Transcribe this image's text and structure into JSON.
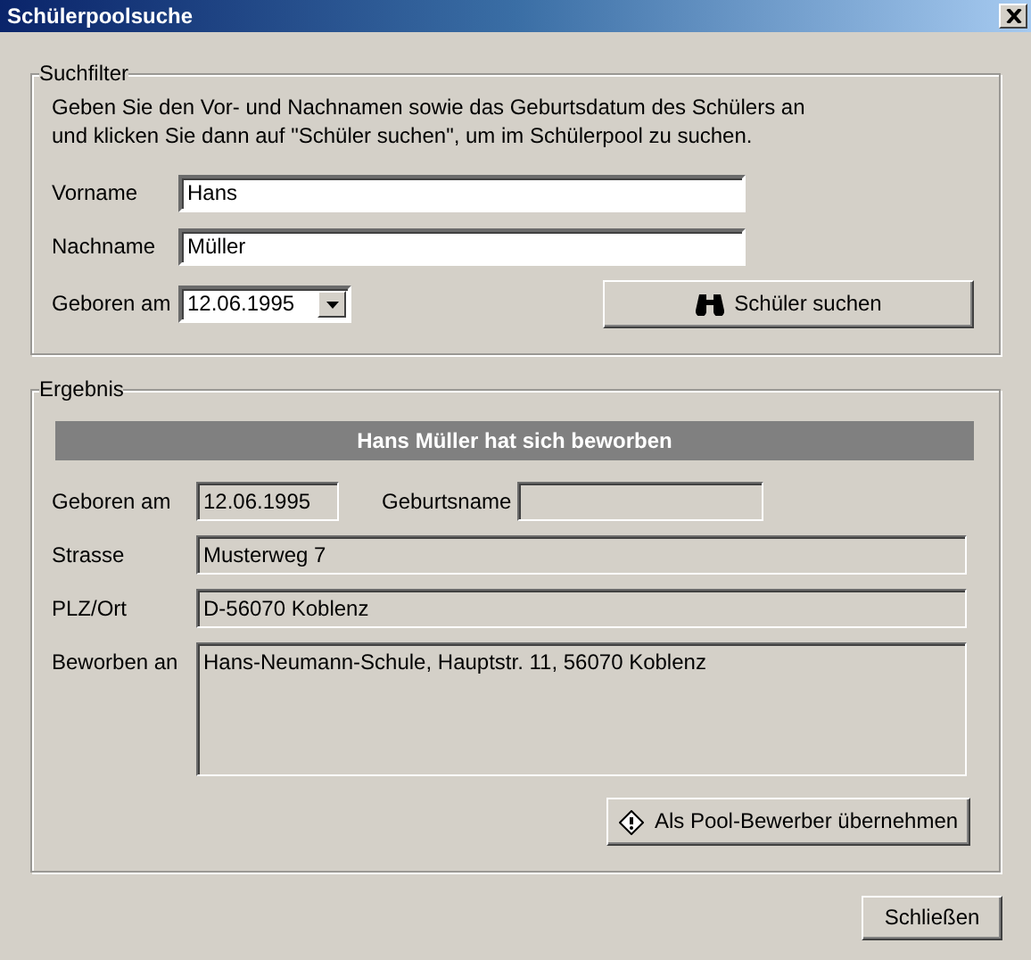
{
  "window": {
    "title": "Schülerpoolsuche"
  },
  "search_filter": {
    "legend": "Suchfilter",
    "instructions": "Geben Sie den Vor- und Nachnamen sowie das Geburtsdatum des Schülers an und klicken Sie dann auf \"Schüler suchen\", um im Schülerpool zu suchen.",
    "fields": [
      {
        "label": "Vorname",
        "value": "Hans"
      },
      {
        "label": "Nachname",
        "value": "Müller"
      }
    ],
    "birth_date": {
      "label": "Geboren am",
      "value": "12.06.1995"
    },
    "search_button": "Schüler suchen"
  },
  "result": {
    "legend": "Ergebnis",
    "header": "Hans Müller hat sich beworben",
    "birth_date": {
      "label": "Geboren am",
      "value": "12.06.1995"
    },
    "birth_name": {
      "label": "Geburtsname"
    },
    "fields": [
      {
        "label": "Strasse",
        "value": "Musterweg 7"
      },
      {
        "label": "PLZ/Ort",
        "value": "D-56070 Koblenz"
      }
    ],
    "applied_to": {
      "label": "Beworben an",
      "value": "Hans-Neumann-Schule, Hauptstr. 11, 56070 Koblenz"
    },
    "adopt_button": "Als Pool-Bewerber übernehmen"
  },
  "close_button": "Schließen"
}
